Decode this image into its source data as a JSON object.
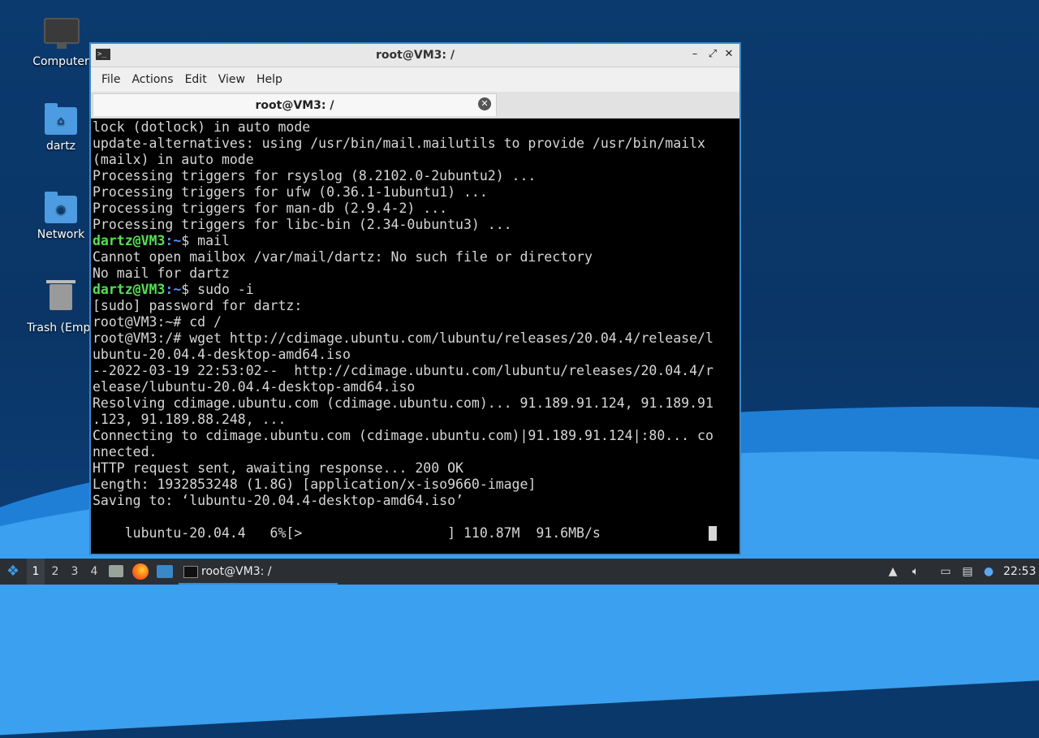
{
  "desktop": {
    "icons": [
      {
        "label": "Computer"
      },
      {
        "label": "dartz"
      },
      {
        "label": "Network"
      },
      {
        "label": "Trash (Empt"
      }
    ]
  },
  "window": {
    "title": "root@VM3: /",
    "menu": [
      "File",
      "Actions",
      "Edit",
      "View",
      "Help"
    ],
    "tab_title": "root@VM3: /"
  },
  "terminal": {
    "lines": [
      {
        "text": "lock (dotlock) in auto mode"
      },
      {
        "text": "update-alternatives: using /usr/bin/mail.mailutils to provide /usr/bin/mailx"
      },
      {
        "text": "(mailx) in auto mode"
      },
      {
        "text": "Processing triggers for rsyslog (8.2102.0-2ubuntu2) ..."
      },
      {
        "text": "Processing triggers for ufw (0.36.1-1ubuntu1) ..."
      },
      {
        "text": "Processing triggers for man-db (2.9.4-2) ..."
      },
      {
        "text": "Processing triggers for libc-bin (2.34-0ubuntu3) ..."
      },
      {
        "user": "dartz@VM3",
        "path": ":~",
        "text": "$ mail"
      },
      {
        "text": "Cannot open mailbox /var/mail/dartz: No such file or directory"
      },
      {
        "text": "No mail for dartz"
      },
      {
        "user": "dartz@VM3",
        "path": ":~",
        "text": "$ sudo -i"
      },
      {
        "text": "[sudo] password for dartz:"
      },
      {
        "text": "root@VM3:~# cd /"
      },
      {
        "text": "root@VM3:/# wget http://cdimage.ubuntu.com/lubuntu/releases/20.04.4/release/l"
      },
      {
        "text": "ubuntu-20.04.4-desktop-amd64.iso"
      },
      {
        "text": "--2022-03-19 22:53:02--  http://cdimage.ubuntu.com/lubuntu/releases/20.04.4/r"
      },
      {
        "text": "elease/lubuntu-20.04.4-desktop-amd64.iso"
      },
      {
        "text": "Resolving cdimage.ubuntu.com (cdimage.ubuntu.com)... 91.189.91.124, 91.189.91"
      },
      {
        "text": ".123, 91.189.88.248, ..."
      },
      {
        "text": "Connecting to cdimage.ubuntu.com (cdimage.ubuntu.com)|91.189.91.124|:80... co"
      },
      {
        "text": "nnected."
      },
      {
        "text": "HTTP request sent, awaiting response... 200 OK"
      },
      {
        "text": "Length: 1932853248 (1.8G) [application/x-iso9660-image]"
      },
      {
        "text": "Saving to: ‘lubuntu-20.04.4-desktop-amd64.iso’"
      },
      {
        "text": ""
      },
      {
        "text": "    lubuntu-20.04.4   6%[>                  ] 110.87M  91.6MB/s"
      }
    ]
  },
  "taskbar": {
    "workspaces": [
      "1",
      "2",
      "3",
      "4"
    ],
    "active_workspace": "1",
    "task_label": "root@VM3: /",
    "clock": "22:53"
  },
  "colors": {
    "prompt_user": "#55e055",
    "prompt_path": "#5c8dff",
    "window_border": "#3b88c8"
  }
}
